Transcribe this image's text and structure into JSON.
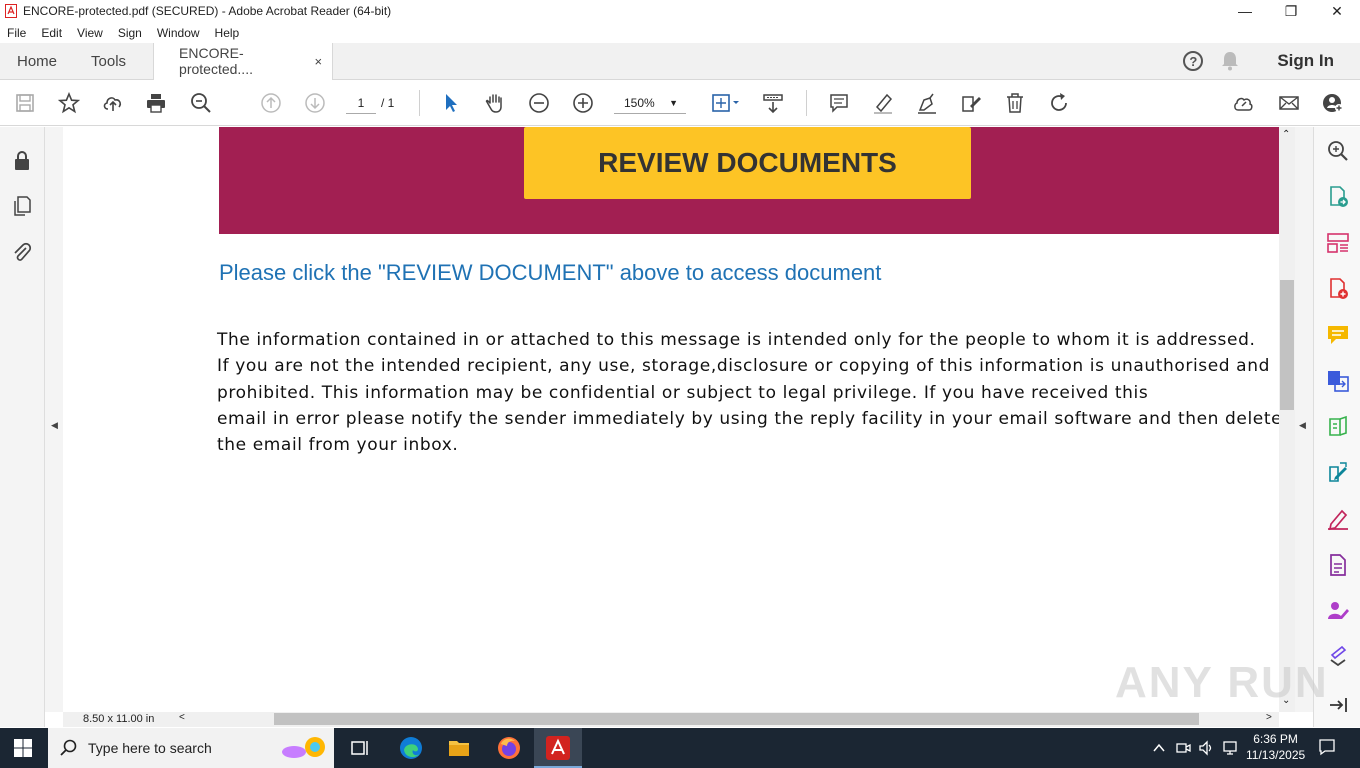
{
  "window": {
    "title": "ENCORE-protected.pdf (SECURED) - Adobe Acrobat Reader (64-bit)",
    "minimize": "—",
    "maximize": "❐",
    "close": "✕"
  },
  "menu": [
    "File",
    "Edit",
    "View",
    "Sign",
    "Window",
    "Help"
  ],
  "tabs": {
    "home": "Home",
    "tools": "Tools",
    "document": "ENCORE-protected....",
    "document_close": "×",
    "help": "?",
    "signin": "Sign In"
  },
  "toolbar": {
    "page_current": "1",
    "page_total": "/ 1",
    "zoom": "150%",
    "zoom_caret": "▼"
  },
  "document": {
    "button_label": "REVIEW DOCUMENTS",
    "click_text": "Please click the \"REVIEW DOCUMENT\" above to access document",
    "disclaimer_lines": [
      "The information contained in or attached to this message is intended only for the people to whom it is addressed.",
      "If you are not the intended recipient, any use, storage,disclosure or copying of this information is unauthorised and",
      "prohibited. This information may be confidential or subject to legal privilege. If you have received this",
      "email in error please notify the sender immediately by using the reply facility in your email software and then delete",
      "the email from your inbox."
    ],
    "colors": {
      "banner": "#a21f52",
      "button": "#fdc425",
      "link_text": "#1f72b4"
    }
  },
  "status": {
    "page_size": "8.50 x 11.00 in",
    "hscroll_left": "<",
    "hscroll_right": ">"
  },
  "panels": {
    "left_collapse": "◀",
    "right_collapse": "◀",
    "vscroll_up": "⌃",
    "vscroll_down": "⌄"
  },
  "watermark": "ANY RUN",
  "taskbar": {
    "search_placeholder": "Type here to search",
    "time": "6:36 PM",
    "date": "11/13/2025"
  }
}
